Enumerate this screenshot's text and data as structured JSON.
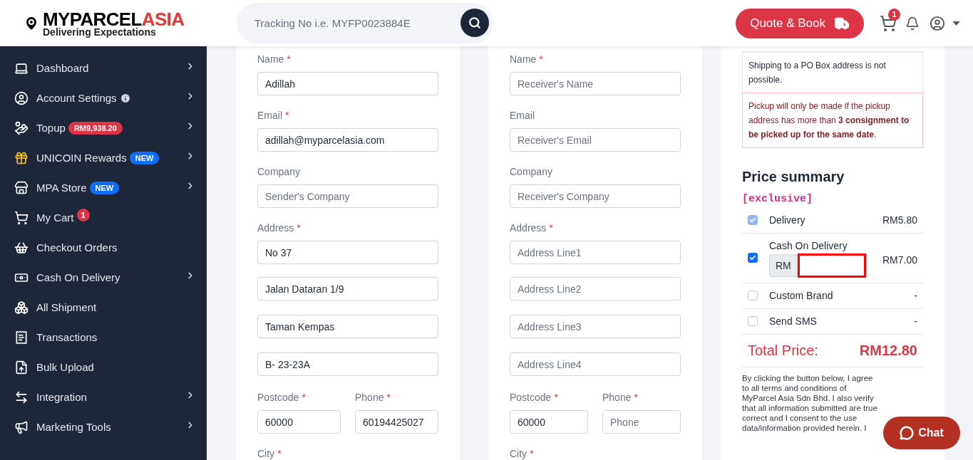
{
  "header": {
    "brand_main": "MYPARCEL",
    "brand_accent": "ASIA",
    "tagline": "Delivering Expectations",
    "search": {
      "placeholder": "Tracking No i.e. MYFP0023884E"
    },
    "quote_button": "Quote & Book",
    "cart_count": "1"
  },
  "sidebar": {
    "items": [
      {
        "label": "Dashboard",
        "expandable": true
      },
      {
        "label": "Account Settings",
        "expandable": true,
        "badge": {
          "kind": "info"
        }
      },
      {
        "label": "Topup",
        "expandable": true,
        "badge": {
          "kind": "money",
          "text": "RM9,938.20"
        }
      },
      {
        "label": "UNICOIN Rewards",
        "expandable": true,
        "badge": {
          "kind": "new",
          "text": "NEW"
        }
      },
      {
        "label": "MPA Store",
        "expandable": true,
        "badge": {
          "kind": "new",
          "text": "NEW"
        }
      },
      {
        "label": "My Cart",
        "expandable": false,
        "badge": {
          "kind": "count",
          "text": "1"
        }
      },
      {
        "label": "Checkout Orders",
        "expandable": false
      },
      {
        "label": "Cash On Delivery",
        "expandable": true
      },
      {
        "label": "All Shipment",
        "expandable": false
      },
      {
        "label": "Transactions",
        "expandable": false
      },
      {
        "label": "Bulk Upload",
        "expandable": false
      },
      {
        "label": "Integration",
        "expandable": true
      },
      {
        "label": "Marketing Tools",
        "expandable": true
      }
    ]
  },
  "forms": [
    {
      "rows": [
        {
          "fields": [
            {
              "label": "Name",
              "required": true,
              "value": "Adillah"
            }
          ]
        },
        {
          "fields": [
            {
              "label": "Email",
              "required": true,
              "value": "adillah@myparcelasia.com"
            }
          ]
        },
        {
          "fields": [
            {
              "label": "Company",
              "required": false,
              "placeholder": "Sender's Company"
            }
          ]
        },
        {
          "fields": [
            {
              "label": "Address",
              "required": true,
              "value": "No 37"
            }
          ]
        },
        {
          "fields": [
            {
              "value": "Jalan Dataran 1/9"
            }
          ]
        },
        {
          "fields": [
            {
              "value": "Taman Kempas"
            }
          ]
        },
        {
          "fields": [
            {
              "value": "B- 23-23A"
            }
          ]
        },
        {
          "fields": [
            {
              "label": "Postcode",
              "required": true,
              "value": "60000"
            },
            {
              "label": "Phone",
              "required": true,
              "value": "60194425027"
            }
          ]
        },
        {
          "fields": [
            {
              "label": "City",
              "required": true
            }
          ]
        }
      ]
    },
    {
      "rows": [
        {
          "fields": [
            {
              "label": "Name",
              "required": true,
              "placeholder": "Receiver's Name"
            }
          ]
        },
        {
          "fields": [
            {
              "label": "Email",
              "required": false,
              "placeholder": "Receiver's Email"
            }
          ]
        },
        {
          "fields": [
            {
              "label": "Company",
              "required": false,
              "placeholder": "Receiver's Company"
            }
          ]
        },
        {
          "fields": [
            {
              "label": "Address",
              "required": true,
              "placeholder": "Address Line1"
            }
          ]
        },
        {
          "fields": [
            {
              "placeholder": "Address Line2"
            }
          ]
        },
        {
          "fields": [
            {
              "placeholder": "Address Line3"
            }
          ]
        },
        {
          "fields": [
            {
              "placeholder": "Address Line4"
            }
          ]
        },
        {
          "fields": [
            {
              "label": "Postcode",
              "required": true,
              "value": "60000"
            },
            {
              "label": "Phone",
              "required": true,
              "placeholder": "Phone"
            }
          ]
        },
        {
          "fields": [
            {
              "label": "City",
              "required": true
            }
          ]
        }
      ]
    }
  ],
  "summary": {
    "notices": [
      {
        "kind": "info",
        "text": "Shipping to a PO Box address is not possible."
      },
      {
        "kind": "warning",
        "text": "Pickup will only be made if the pickup address has more than **3 consignment to be picked up for the same date**."
      }
    ],
    "title": "Price summary",
    "note": "[exclusive]",
    "items": [
      {
        "kind": "plain",
        "label": "Delivery",
        "checked": true,
        "disabled": true,
        "price": "RM5.80"
      },
      {
        "kind": "amount",
        "label": "Cash On Delivery",
        "checked": true,
        "disabled": false,
        "prefix": "RM",
        "highlighted": true,
        "price": "RM7.00"
      },
      {
        "kind": "plain",
        "label": "Custom Brand",
        "checked": false,
        "disabled": false,
        "price": "-"
      },
      {
        "kind": "plain",
        "label": "Send SMS",
        "checked": false,
        "disabled": false,
        "price": "-"
      }
    ],
    "total_label": "Total Price:",
    "total_value": "RM12.80",
    "terms": "By clicking the button below, I agree to all terms and conditions of MyParcel Asia Sdn Bhd. I also verify that all information submitted are true correct and I consent to the use data/information provided herein. I"
  },
  "required_mark": "*",
  "chat_button": "Chat"
}
